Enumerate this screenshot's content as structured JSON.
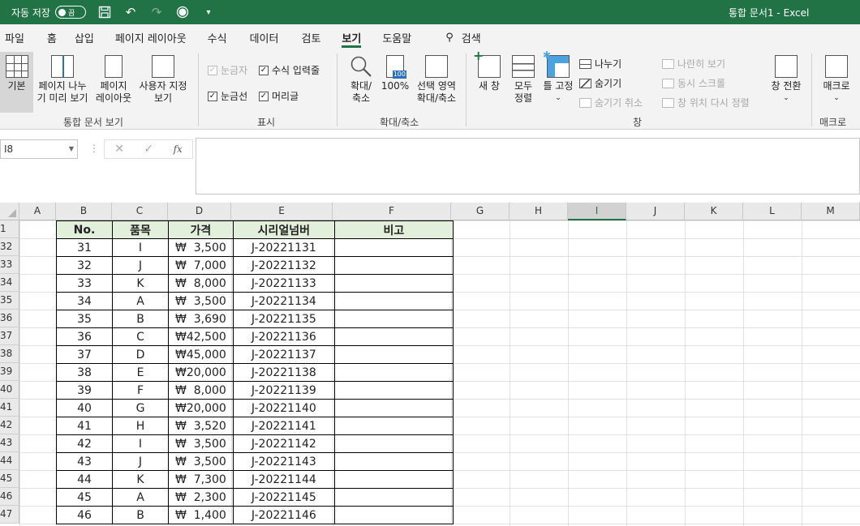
{
  "titlebar": {
    "autosave_label": "자동 저장",
    "autosave_state": "끔",
    "doc_title": "통합 문서1  -  Excel"
  },
  "tabs": [
    "파일",
    "홈",
    "삽입",
    "페이지 레이아웃",
    "수식",
    "데이터",
    "검토",
    "보기",
    "도움말"
  ],
  "active_tab": "보기",
  "search_label": "검색",
  "ribbon": {
    "workbook_views": {
      "normal": "기본",
      "page_break_1": "페이지 나누",
      "page_break_2": "기 미리 보기",
      "page_layout_1": "페이지",
      "page_layout_2": "레이아웃",
      "custom_1": "사용자 지정",
      "custom_2": "보기",
      "group": "통합 문서 보기"
    },
    "show": {
      "ruler": "눈금자",
      "formula_bar": "수식 입력줄",
      "gridlines": "눈금선",
      "headings": "머리글",
      "group": "표시"
    },
    "zoom": {
      "zoom_1": "확대/",
      "zoom_2": "축소",
      "hundred": "100%",
      "zoom_sel_1": "선택 영역",
      "zoom_sel_2": "확대/축소",
      "group": "확대/축소"
    },
    "window": {
      "new_window": "새 창",
      "arrange_1": "모두",
      "arrange_2": "정렬",
      "freeze": "틀 고정",
      "split": "나누기",
      "hide": "숨기기",
      "unhide": "숨기기 취소",
      "side_by_side": "나란히 보기",
      "sync_scroll": "동시 스크롤",
      "reset_pos": "창 위치 다시 정렬",
      "switch_1": "창 전환",
      "group": "창"
    },
    "macros": {
      "macro": "매크로",
      "group": "매크로"
    }
  },
  "formula": {
    "namebox": "I8",
    "fx": "fx"
  },
  "columns": [
    "A",
    "B",
    "C",
    "D",
    "E",
    "F",
    "G",
    "H",
    "I",
    "J",
    "K",
    "L",
    "M"
  ],
  "selected_column": "I",
  "header_row_num": "1",
  "table": {
    "headers": [
      "No.",
      "품목",
      "가격",
      "시리얼넘버",
      "비고"
    ],
    "currency": "₩",
    "rows": [
      {
        "row": "32",
        "no": "31",
        "item": "I",
        "price": "3,500",
        "serial": "J-20221131"
      },
      {
        "row": "33",
        "no": "32",
        "item": "J",
        "price": "7,000",
        "serial": "J-20221132"
      },
      {
        "row": "34",
        "no": "33",
        "item": "K",
        "price": "8,000",
        "serial": "J-20221133"
      },
      {
        "row": "35",
        "no": "34",
        "item": "A",
        "price": "3,500",
        "serial": "J-20221134"
      },
      {
        "row": "36",
        "no": "35",
        "item": "B",
        "price": "3,690",
        "serial": "J-20221135"
      },
      {
        "row": "37",
        "no": "36",
        "item": "C",
        "price": "42,500",
        "serial": "J-20221136"
      },
      {
        "row": "38",
        "no": "37",
        "item": "D",
        "price": "45,000",
        "serial": "J-20221137"
      },
      {
        "row": "39",
        "no": "38",
        "item": "E",
        "price": "20,000",
        "serial": "J-20221138"
      },
      {
        "row": "40",
        "no": "39",
        "item": "F",
        "price": "8,000",
        "serial": "J-20221139"
      },
      {
        "row": "41",
        "no": "40",
        "item": "G",
        "price": "20,000",
        "serial": "J-20221140"
      },
      {
        "row": "42",
        "no": "41",
        "item": "H",
        "price": "3,520",
        "serial": "J-20221141"
      },
      {
        "row": "43",
        "no": "42",
        "item": "I",
        "price": "3,500",
        "serial": "J-20221142"
      },
      {
        "row": "44",
        "no": "43",
        "item": "J",
        "price": "3,500",
        "serial": "J-20221143"
      },
      {
        "row": "45",
        "no": "44",
        "item": "K",
        "price": "7,300",
        "serial": "J-20221144"
      },
      {
        "row": "46",
        "no": "45",
        "item": "A",
        "price": "2,300",
        "serial": "J-20221145"
      },
      {
        "row": "47",
        "no": "46",
        "item": "B",
        "price": "1,400",
        "serial": "J-20221146"
      }
    ]
  },
  "colors": {
    "excel_green": "#217346",
    "header_fill": "#e2efda"
  }
}
